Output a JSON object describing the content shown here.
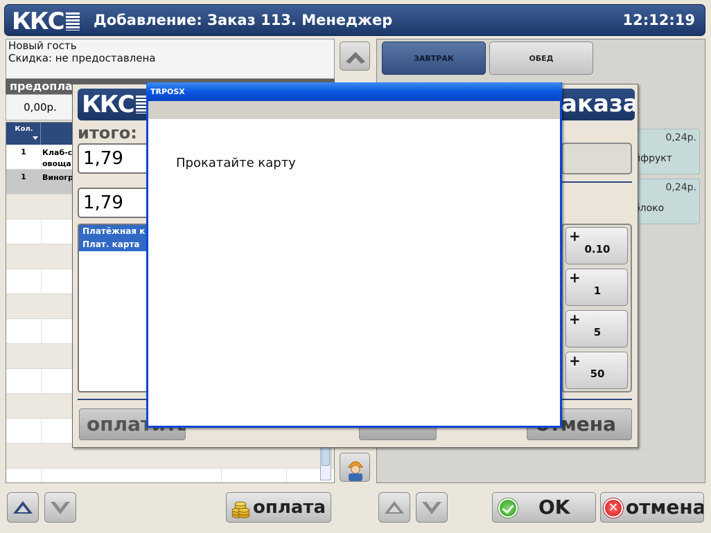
{
  "header": {
    "logo": "ККС",
    "title": "Добавление:  Заказ 113. Менеджер",
    "clock": "12:12:19"
  },
  "guest": {
    "name": "Новый гость",
    "discount": "Скидка: не предоставлена",
    "prepay_label": "предоплата    скидка",
    "prepay_value": "0,00р."
  },
  "order_table": {
    "header_qty": "Кол.",
    "rows": [
      {
        "qty": "1",
        "name": "Клаб-с\nовоща"
      },
      {
        "qty": "1",
        "name": "Виногр"
      }
    ]
  },
  "categories": [
    {
      "label": "ЗАВТРАК",
      "selected": true
    },
    {
      "label": "ОБЕД",
      "selected": false
    }
  ],
  "products": [
    {
      "price": "0,24р.",
      "name": "йфрукт"
    },
    {
      "price": "0,24р.",
      "name": "блоко"
    }
  ],
  "payment_dialog": {
    "logo": "ККС",
    "title_fragment": "аказа",
    "itogo_label": "итого:",
    "total": "1,79",
    "paid": "1,79",
    "methods": [
      "Платёжная к",
      "Плат. карта"
    ],
    "pay_button": "оплатить",
    "cancel_button": "отмена",
    "denominations": [
      "0.10",
      "1",
      "5",
      "50"
    ],
    "plus": "+"
  },
  "modal": {
    "title": "TRPOSX",
    "message": "Прокатайте карту"
  },
  "toolbar": {
    "payment": "оплата",
    "ok": "OK",
    "cancel": "отмена",
    "cancel_icon": "x-icon",
    "arrow_color": "#2c4a7c",
    "arrow_color_disabled": "#8a8a8a"
  }
}
